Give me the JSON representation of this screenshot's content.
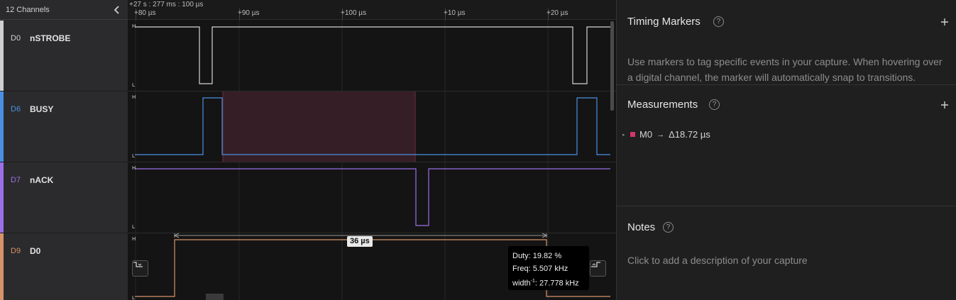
{
  "channels": {
    "count_label": "12 Channels",
    "items": [
      {
        "id": "D0",
        "name": "nSTROBE",
        "color": "#cfcfcf"
      },
      {
        "id": "D6",
        "name": "BUSY",
        "color": "#4a90e2"
      },
      {
        "id": "D7",
        "name": "nACK",
        "color": "#9b6fe8"
      },
      {
        "id": "D9",
        "name": "D0",
        "color": "#d6936a"
      }
    ]
  },
  "timeline": {
    "origin": "+27 s : 277 ms : 100 µs",
    "ticks": [
      "+80 µs",
      "+90 µs",
      "+100 µs",
      "+10 µs",
      "+20 µs"
    ]
  },
  "levels": {
    "high": "H",
    "low": "L"
  },
  "measurement_overlay": {
    "width_label": "36 µs",
    "duty": "Duty: 19.82 %",
    "freq": "Freq: 5.507 kHz",
    "width_inv_prefix": "width",
    "width_inv_sup": "-1",
    "width_inv_value": ": 27.778 kHz",
    "highlight_color": "#3a1f28"
  },
  "panel": {
    "timing_markers": {
      "title": "Timing Markers",
      "help": "?",
      "description": "Use markers to tag specific events in your capture. When hovering over a digital channel, the marker will automatically snap to transitions."
    },
    "measurements": {
      "title": "Measurements",
      "help": "?",
      "items": [
        {
          "caret": "▸",
          "label": "M0",
          "arrow": "→",
          "value": "Δ18.72 µs",
          "color": "#d6336c"
        }
      ]
    },
    "notes": {
      "title": "Notes",
      "help": "?",
      "placeholder": "Click to add a description of your capture"
    }
  }
}
